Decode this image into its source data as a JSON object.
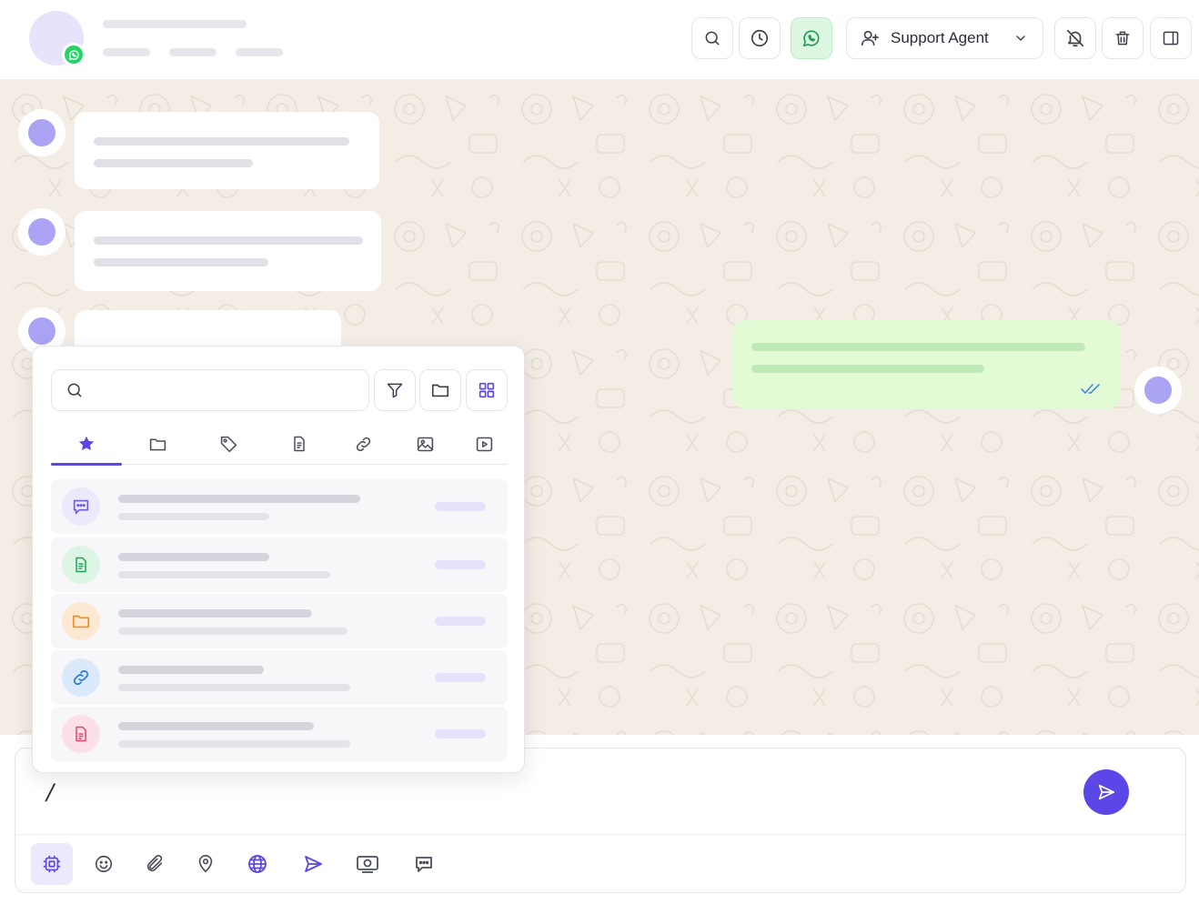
{
  "header": {
    "agent_select": {
      "value": "Support Agent",
      "icon": "user-plus-icon"
    },
    "buttons": [
      {
        "name": "search-button",
        "icon": "search-icon"
      },
      {
        "name": "history-button",
        "icon": "clock-icon"
      },
      {
        "name": "whatsapp-button",
        "icon": "whatsapp-icon"
      },
      {
        "name": "mute-notifications-button",
        "icon": "bell-off-icon"
      },
      {
        "name": "delete-button",
        "icon": "trash-icon"
      },
      {
        "name": "toggle-panel-button",
        "icon": "panel-icon"
      }
    ]
  },
  "composer": {
    "text": "/",
    "tools": [
      "templates-icon",
      "emoji-icon",
      "attachment-icon",
      "location-icon",
      "globe-icon",
      "send-outline-icon",
      "media-icon",
      "chat-icon"
    ]
  },
  "quick_replies": {
    "search": {
      "placeholder": ""
    },
    "tabs": [
      "star-icon",
      "folder-icon",
      "tag-icon",
      "document-icon",
      "link-icon",
      "image-icon",
      "video-icon"
    ],
    "items": [
      {
        "icon": "message-icon",
        "color": "#6d5ce8",
        "bg": "#ece9fd"
      },
      {
        "icon": "file-icon",
        "color": "#22a55b",
        "bg": "#dcf5e4"
      },
      {
        "icon": "folder-icon",
        "color": "#f08c1e",
        "bg": "#fde9d2"
      },
      {
        "icon": "link-icon",
        "color": "#2f7fe0",
        "bg": "#dbeafb"
      },
      {
        "icon": "pdf-icon",
        "color": "#e2476a",
        "bg": "#fbe1e7"
      }
    ]
  },
  "colors": {
    "accent": "#5b46e8",
    "whatsapp": "#25d366",
    "chat_background": "#f4ede5",
    "outgoing_bubble": "#e3fbd5",
    "read_ticks": "#4a86e8"
  }
}
